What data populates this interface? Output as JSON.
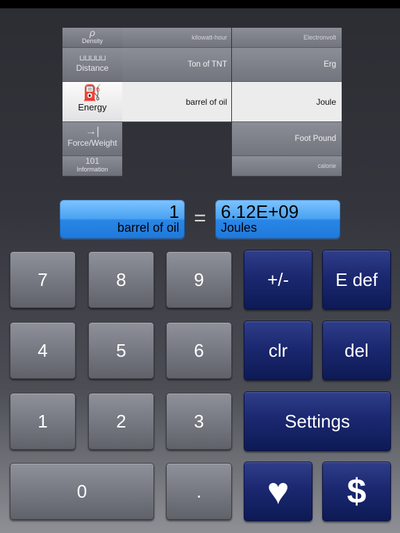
{
  "categories": [
    {
      "name": "density",
      "label": "Density",
      "icon": "density-icon",
      "glyph": "ρ"
    },
    {
      "name": "distance",
      "label": "Distance",
      "icon": "ruler-icon",
      "glyph": "⊔⊔⊔⊔⊔"
    },
    {
      "name": "energy",
      "label": "Energy",
      "icon": "fuel-pump-icon",
      "glyph": "⛽"
    },
    {
      "name": "force-weight",
      "label": "Force/Weight",
      "icon": "arrow-to-bar-icon",
      "glyph": "→|"
    },
    {
      "name": "information",
      "label": "Information",
      "icon": "binary-icon",
      "glyph": "101"
    }
  ],
  "from_units": [
    "kilowatt-hour",
    "Ton of TNT",
    "barrel of oil"
  ],
  "to_units": [
    "Electronvolt",
    "Erg",
    "Joule",
    "Foot Pound",
    "calorie"
  ],
  "selected_category": "Energy",
  "from_display": {
    "value": "1",
    "unit": "barrel of oil"
  },
  "to_display": {
    "value": "6.12E+09",
    "unit": "Joules"
  },
  "equals_sign": "=",
  "keys": {
    "k7": "7",
    "k8": "8",
    "k9": "9",
    "plusminus": "+/-",
    "edef": "E def",
    "k4": "4",
    "k5": "5",
    "k6": "6",
    "clr": "clr",
    "del": "del",
    "k1": "1",
    "k2": "2",
    "k3": "3",
    "settings": "Settings",
    "k0": "0",
    "dot": ".",
    "heart": "♥",
    "dollar": "$"
  },
  "colors": {
    "display_blue": "#3a94ec",
    "key_blue": "#1b2870",
    "key_gray": "#74777f"
  }
}
